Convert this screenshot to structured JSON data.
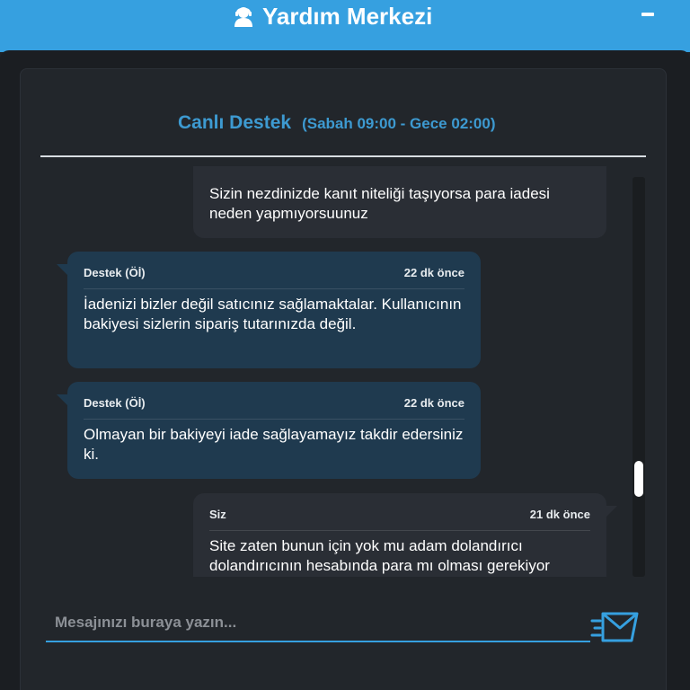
{
  "header": {
    "title": "Yardım Merkezi",
    "icon": "support-agent-icon",
    "accent_color": "#36a0e0"
  },
  "chat": {
    "title": "Canlı Destek",
    "hours": "(Sabah 09:00 - Gece 02:00)",
    "messages": [
      {
        "kind": "user",
        "sender": "",
        "time": "",
        "text": "Sizin nezdinizde kanıt niteliği taşıyorsa para iadesi neden yapmıyorsuunuz"
      },
      {
        "kind": "agent",
        "sender": "Destek (Öİ)",
        "time": "22 dk önce",
        "text": "İadenizi bizler değil satıcınız sağlamaktalar. Kullanıcının bakiyesi sizlerin sipariş tutarınızda değil."
      },
      {
        "kind": "agent",
        "sender": "Destek (Öİ)",
        "time": "22 dk önce",
        "text": "Olmayan bir bakiyeyi iade sağlayamayız takdir edersiniz ki."
      },
      {
        "kind": "user",
        "sender": "Siz",
        "time": "21 dk önce",
        "text": "Site zaten bunun için yok mu adam dolandırıcı dolandırıcının hesabında para mı olması gerekiyor"
      }
    ]
  },
  "composer": {
    "placeholder": "Mesajınızı buraya yazın...",
    "send_icon": "send-icon"
  }
}
